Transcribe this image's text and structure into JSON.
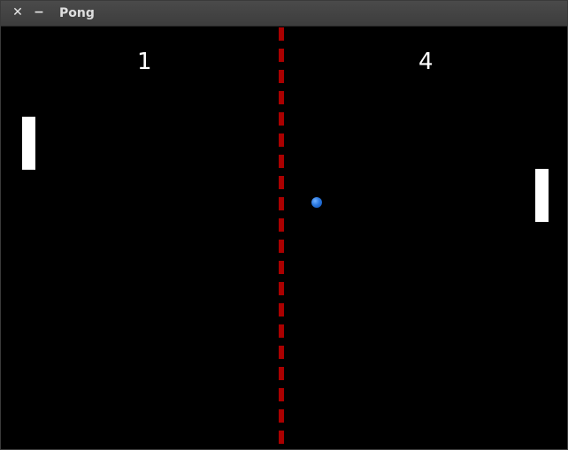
{
  "window": {
    "title": "Pong",
    "close_glyph": "✕",
    "minimize_glyph": "−"
  },
  "game": {
    "scores": {
      "left": "1",
      "right": "4"
    },
    "colors": {
      "background": "#000000",
      "net": "#aa0000",
      "paddle": "#ffffff",
      "ball": "#2a78e0",
      "score": "#ffffff"
    }
  }
}
